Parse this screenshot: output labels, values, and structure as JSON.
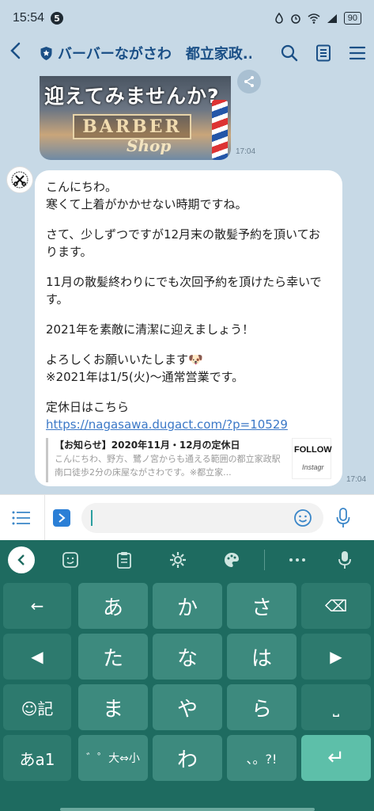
{
  "status_bar": {
    "time": "15:54",
    "notification_count": "5",
    "battery": "90"
  },
  "header": {
    "back_icon": "chevron-left-icon",
    "title": "バーバーながさわ　都立家政...",
    "icons": [
      "search-icon",
      "note-icon",
      "menu-icon"
    ]
  },
  "chat": {
    "image_message": {
      "banner_text": "迎えてみませんか?",
      "barber_text": "BARBER",
      "shop_text": "Shop",
      "time": "17:04"
    },
    "text_message": {
      "lines": [
        "こんにちわ。\n寒くて上着がかかせない時期ですね。",
        "さて、少しずつですが12月末の散髪予約を頂いております。",
        "11月の散髪終わりにでも次回予約を頂けたら幸いです。",
        "2021年を素敵に清潔に迎えましょう！",
        "よろしくお願いいたします🐶\n※2021年は1/5(火)〜通常営業です。",
        "定休日はこちら"
      ],
      "link": "https://nagasawa.dugact.com/?p=10529",
      "preview_title": "【お知らせ】2020年11月・12月の定休日",
      "preview_desc": "こんにちわ、野方、鷺ノ宮からも通える範囲の都立家政駅南口徒歩2分の床屋ながさわです。※都立家...",
      "preview_thumb_1": "FOLLOW",
      "preview_thumb_2": "Instagr",
      "time": "17:04"
    }
  },
  "input_bar": {
    "placeholder": ""
  },
  "keyboard": {
    "rows": [
      [
        "←",
        "あ",
        "か",
        "さ",
        "⌫"
      ],
      [
        "◀",
        "た",
        "な",
        "は",
        "▶"
      ],
      [
        "☺記",
        "ま",
        "や",
        "ら",
        "⎵"
      ],
      [
        "あa1",
        "゛゜大⇔小",
        "わ",
        "、。?!",
        "↵"
      ]
    ]
  }
}
